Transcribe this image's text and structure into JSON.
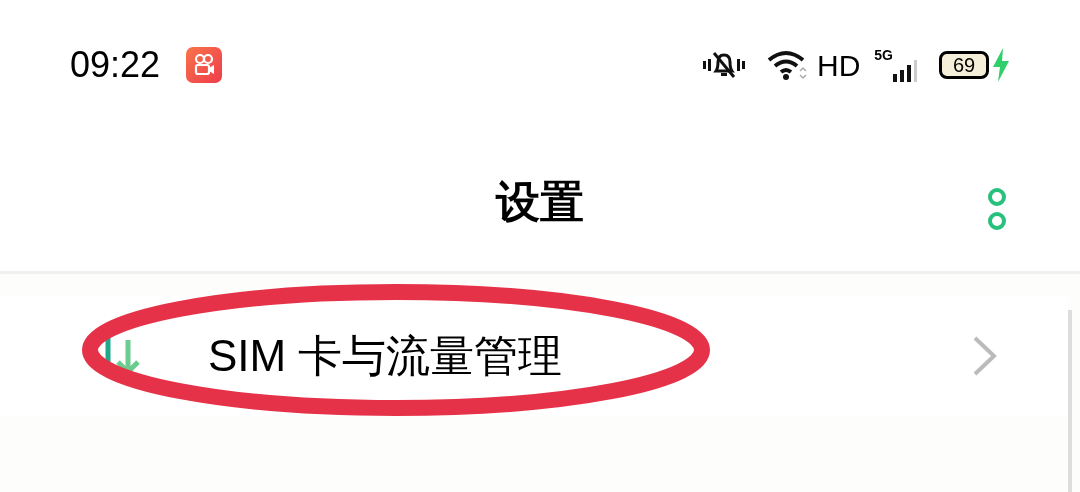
{
  "status_bar": {
    "time": "09:22",
    "network_label": "HD",
    "signal_label": "5G",
    "battery": "69",
    "charging": true
  },
  "header": {
    "title": "设置"
  },
  "items": [
    {
      "label": "SIM 卡与流量管理",
      "highlighted": true
    }
  ]
}
